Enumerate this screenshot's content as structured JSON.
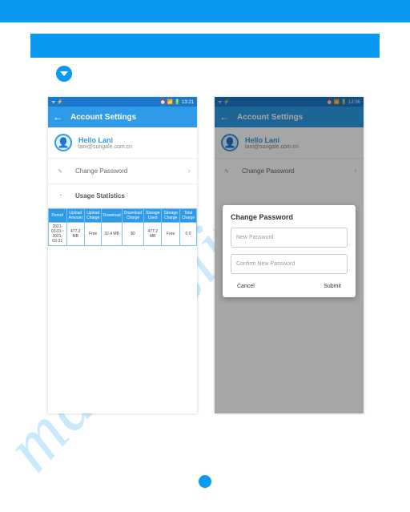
{
  "watermark": "manualslive.co",
  "phone_left": {
    "status_left": "ᯤ ⚡",
    "status_right": "⏰ 📶 🔋 13:21",
    "appbar_title": "Account Settings",
    "user_name": "Hello Lani",
    "user_email": "lani@sungale.com.cn",
    "change_password": "Change Password",
    "usage_title": "Usage Statistics",
    "table": {
      "headers": [
        "Period",
        "Upload Amount",
        "Upload Charge",
        "Download",
        "Download Charge",
        "Storage Used",
        "Storage Charge",
        "Total Charge"
      ],
      "row": [
        "2021-03-01~ 2021-03-31",
        "477.2 MB",
        "Free",
        "32.4 MB",
        "$0",
        "477.2 MB",
        "Free",
        "0.0"
      ]
    }
  },
  "phone_right": {
    "status_left": "ᯤ ⚡",
    "status_right": "⏰ 📶 🔋 12:36",
    "appbar_title": "Account Settings",
    "user_name": "Hello Lani",
    "user_email": "lani@sungale.com.cn",
    "change_password": "Change Password",
    "dialog": {
      "title": "Change Password",
      "new_pw": "New Password",
      "confirm_pw": "Confirm New Password",
      "cancel": "Cancel",
      "submit": "Submit"
    }
  }
}
